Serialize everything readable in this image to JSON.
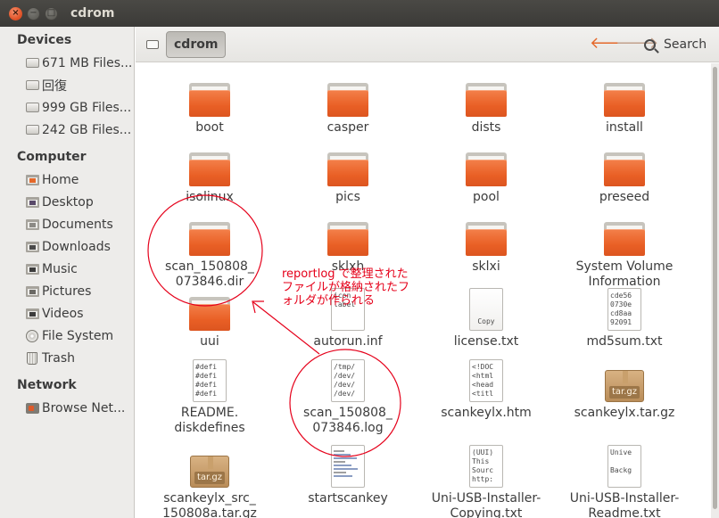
{
  "window": {
    "title": "cdrom",
    "close_glyph": "×",
    "min_glyph": "−",
    "max_glyph": "□"
  },
  "sidebar": {
    "sections": [
      {
        "title": "Devices",
        "items": [
          {
            "label": "671 MB Files...",
            "icon": "drive-icon"
          },
          {
            "label": "回復",
            "icon": "drive-icon"
          },
          {
            "label": "999 GB Files...",
            "icon": "drive-icon"
          },
          {
            "label": "242 GB Files...",
            "icon": "drive-icon"
          }
        ]
      },
      {
        "title": "Computer",
        "items": [
          {
            "label": "Home",
            "icon": "home-icon"
          },
          {
            "label": "Desktop",
            "icon": "desktop-icon"
          },
          {
            "label": "Documents",
            "icon": "documents-icon"
          },
          {
            "label": "Downloads",
            "icon": "downloads-icon"
          },
          {
            "label": "Music",
            "icon": "music-icon"
          },
          {
            "label": "Pictures",
            "icon": "pictures-icon"
          },
          {
            "label": "Videos",
            "icon": "videos-icon"
          },
          {
            "label": "File System",
            "icon": "filesystem-icon"
          },
          {
            "label": "Trash",
            "icon": "trash-icon"
          }
        ]
      },
      {
        "title": "Network",
        "items": [
          {
            "label": "Browse Net...",
            "icon": "network-icon"
          }
        ]
      }
    ]
  },
  "toolbar": {
    "breadcrumb": "cdrom",
    "search_label": "Search",
    "back_glyph": "🡐",
    "forward_glyph": "🡒"
  },
  "files": [
    {
      "name": "boot",
      "type": "folder"
    },
    {
      "name": "casper",
      "type": "folder"
    },
    {
      "name": "dists",
      "type": "folder"
    },
    {
      "name": "install",
      "type": "folder"
    },
    {
      "name": "isolinux",
      "type": "folder"
    },
    {
      "name": "pics",
      "type": "folder"
    },
    {
      "name": "pool",
      "type": "folder"
    },
    {
      "name": "preseed",
      "type": "folder"
    },
    {
      "name": "scan_150808_\n073846.dir",
      "type": "folder"
    },
    {
      "name": "sklxh",
      "type": "folder"
    },
    {
      "name": "sklxi",
      "type": "folder"
    },
    {
      "name": "System Volume\nInformation",
      "type": "folder"
    },
    {
      "name": "uui",
      "type": "folder"
    },
    {
      "name": "autorun.inf",
      "type": "text",
      "preview": "icon\nlabel"
    },
    {
      "name": "license.txt",
      "type": "binary",
      "preview": "Copy"
    },
    {
      "name": "md5sum.txt",
      "type": "text",
      "preview": "cde56\n0730e\ncd8aa\n92091"
    },
    {
      "name": "README.\ndiskdefines",
      "type": "text",
      "preview": "#defi\n#defi\n#defi\n#defi"
    },
    {
      "name": "scan_150808_\n073846.log",
      "type": "text",
      "preview": "/tmp/\n/dev/\n/dev/\n/dev/"
    },
    {
      "name": "scankeylx.htm",
      "type": "text",
      "preview": "<!DOC\n<html\n<head\n<titl"
    },
    {
      "name": "scankeylx.tar.gz",
      "type": "archive",
      "tag": "tar.gz"
    },
    {
      "name": "scankeylx_src_\n150808a.tar.gz",
      "type": "archive",
      "tag": "tar.gz"
    },
    {
      "name": "startscankey",
      "type": "exec"
    },
    {
      "name": "Uni-USB-Installer-\nCopying.txt",
      "type": "text",
      "preview": "(UUI)\nThis\nSourc\nhttp:"
    },
    {
      "name": "Uni-USB-Installer-\nReadme.txt",
      "type": "text",
      "preview": "Unive\n\nBackg"
    }
  ],
  "annotation": {
    "text": "reportlog で整理された\nファイルが格納されたフ\nォルダが作られる",
    "color": "#e5001a"
  }
}
